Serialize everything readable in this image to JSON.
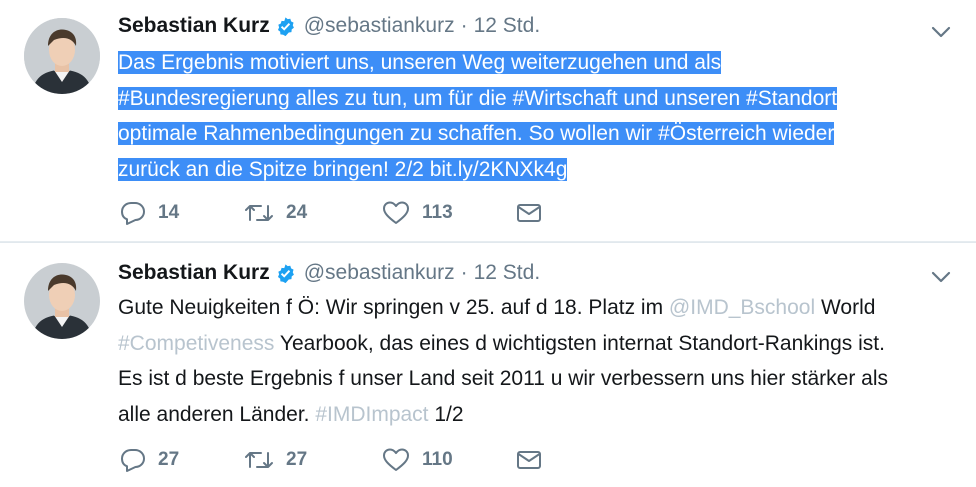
{
  "tweets": [
    {
      "author_name": "Sebastian Kurz",
      "handle": "@sebastiankurz",
      "separator": "·",
      "time": "12 Std.",
      "text_lines": [
        "Das Ergebnis motiviert uns, unseren Weg weiterzugehen und als",
        "#Bundesregierung alles zu tun, um für die #Wirtschaft und unseren #Standort",
        "optimale Rahmenbedingungen zu schaffen. So wollen wir #Österreich wieder",
        "zurück an die Spitze bringen! 2/2 bit.ly/2KNXk4g"
      ],
      "replies": "14",
      "retweets": "24",
      "likes": "113",
      "text_selected": true
    },
    {
      "author_name": "Sebastian Kurz",
      "handle": "@sebastiankurz",
      "separator": "·",
      "time": "12 Std.",
      "text": {
        "l1_a": "Gute Neuigkeiten f Ö: Wir springen v 25. auf d 18. Platz im ",
        "l1_link": "@IMD_Bschool",
        "l1_b": " World",
        "l2_tag": "#Competiveness",
        "l2_b": " Yearbook, das eines d wichtigsten internat Standort-Rankings ist.",
        "l3": "Es ist d beste Ergebnis f unser Land seit 2011 u wir verbessern uns hier stärker als",
        "l4_a": "alle anderen Länder. ",
        "l4_tag": "#IMDImpact",
        "l4_b": " 1/2"
      },
      "replies": "27",
      "retweets": "27",
      "likes": "110"
    }
  ],
  "colors": {
    "selection": "#3d8ef7",
    "secondary_text": "#657786",
    "dim_link": "#b8c4ce",
    "verified_blue": "#1da1f2"
  },
  "icons": [
    "avatar",
    "verified-badge-icon",
    "chevron-down-icon",
    "reply-icon",
    "retweet-icon",
    "like-icon",
    "direct-message-icon"
  ]
}
